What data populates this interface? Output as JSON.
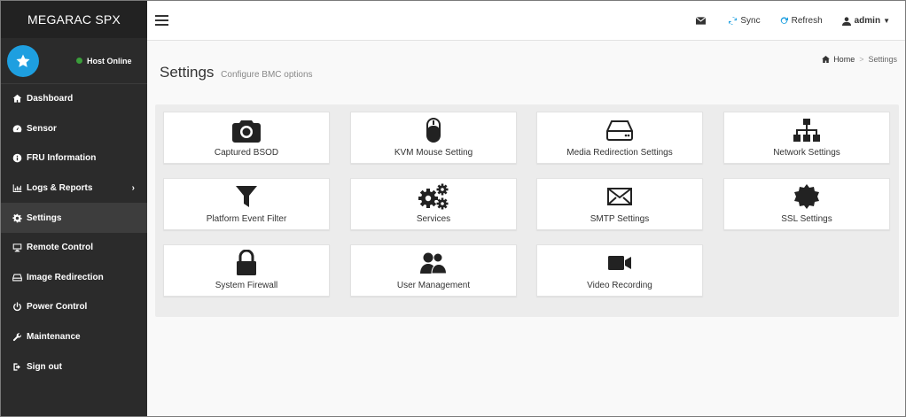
{
  "sidebar": {
    "brand": "MEGARAC SPX",
    "host_status": "Host Online",
    "items": [
      {
        "label": "Dashboard",
        "icon": "dashboard-icon"
      },
      {
        "label": "Sensor",
        "icon": "sensor-icon"
      },
      {
        "label": "FRU Information",
        "icon": "info-icon"
      },
      {
        "label": "Logs & Reports",
        "icon": "chart-icon"
      },
      {
        "label": "Settings",
        "icon": "gear-icon"
      },
      {
        "label": "Remote Control",
        "icon": "monitor-icon"
      },
      {
        "label": "Image Redirection",
        "icon": "drive-icon"
      },
      {
        "label": "Power Control",
        "icon": "power-icon"
      },
      {
        "label": "Maintenance",
        "icon": "wrench-icon"
      },
      {
        "label": "Sign out",
        "icon": "sign-out-icon"
      }
    ],
    "active_item": "Settings"
  },
  "topbar": {
    "sync_label": "Sync",
    "refresh_label": "Refresh",
    "user_label": "admin"
  },
  "page": {
    "title": "Settings",
    "subtitle": "Configure BMC options"
  },
  "breadcrumb": {
    "home": "Home",
    "separator": ">",
    "current": "Settings"
  },
  "tiles": [
    {
      "label": "Captured BSOD",
      "icon": "camera-icon"
    },
    {
      "label": "KVM Mouse Setting",
      "icon": "mouse-icon"
    },
    {
      "label": "Media Redirection Settings",
      "icon": "hard-drive-icon"
    },
    {
      "label": "Network Settings",
      "icon": "sitemap-icon"
    },
    {
      "label": "Platform Event Filter",
      "icon": "filter-icon"
    },
    {
      "label": "Services",
      "icon": "cogs-icon"
    },
    {
      "label": "SMTP Settings",
      "icon": "envelope-icon"
    },
    {
      "label": "SSL Settings",
      "icon": "certificate-icon"
    },
    {
      "label": "System Firewall",
      "icon": "lock-icon"
    },
    {
      "label": "User Management",
      "icon": "users-icon"
    },
    {
      "label": "Video Recording",
      "icon": "video-camera-icon"
    }
  ],
  "colors": {
    "sidebar_bg": "#2b2b2b",
    "brand_bg": "#222222",
    "accent_blue": "#1e9fe0",
    "online_green": "#3a9d3a",
    "panel_bg": "#ececec"
  }
}
